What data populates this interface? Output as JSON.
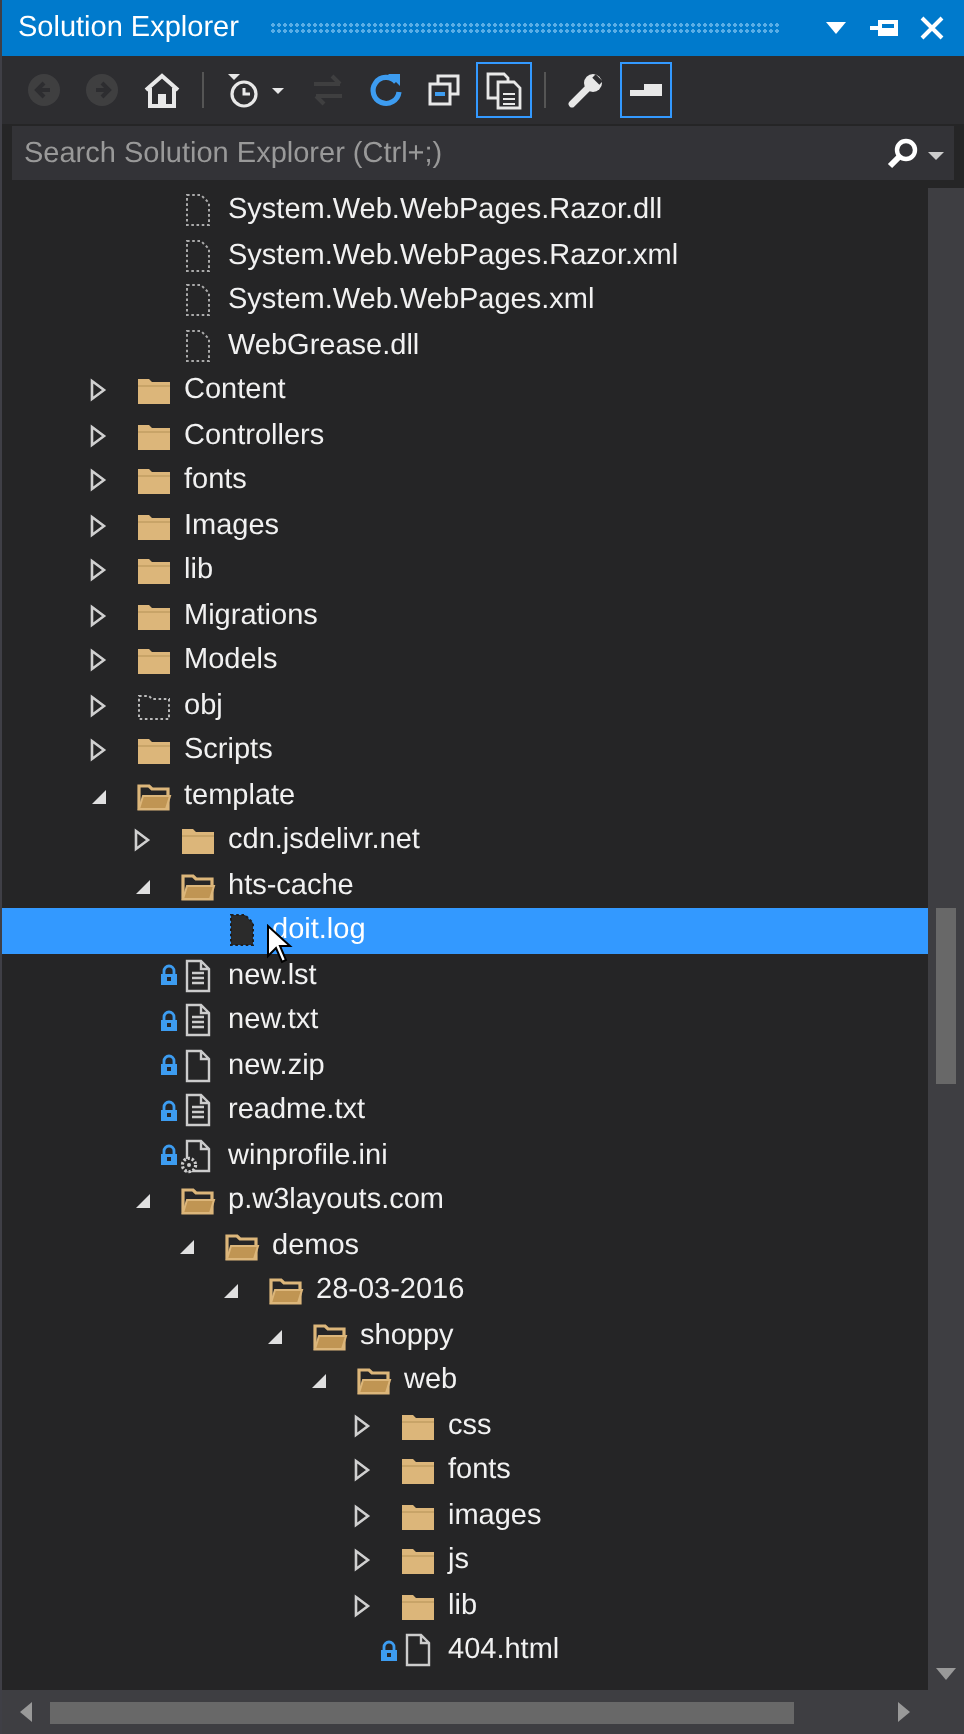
{
  "window": {
    "title": "Solution Explorer"
  },
  "toolbar": [
    {
      "kind": "back",
      "disabled": true,
      "on": false
    },
    {
      "kind": "forward",
      "disabled": true,
      "on": false
    },
    {
      "kind": "home",
      "disabled": false,
      "on": false
    },
    {
      "kind": "separator"
    },
    {
      "kind": "history",
      "disabled": false,
      "on": false
    },
    {
      "kind": "sync",
      "disabled": true,
      "on": false
    },
    {
      "kind": "refresh",
      "disabled": false,
      "on": false
    },
    {
      "kind": "collapse",
      "disabled": false,
      "on": false
    },
    {
      "kind": "show-all",
      "disabled": false,
      "on": true
    },
    {
      "kind": "separator"
    },
    {
      "kind": "properties",
      "disabled": false,
      "on": false
    },
    {
      "kind": "preview",
      "disabled": false,
      "on": true
    }
  ],
  "search": {
    "placeholder": "Search Solution Explorer (Ctrl+;)"
  },
  "tree": {
    "continued_items": [
      {
        "label": "System.Web.WebPages.Razor.dll",
        "kind": "file-excluded",
        "locked": false,
        "selected": false
      },
      {
        "label": "System.Web.WebPages.Razor.xml",
        "kind": "file-excluded",
        "locked": false,
        "selected": false
      },
      {
        "label": "System.Web.WebPages.xml",
        "kind": "file-excluded",
        "locked": false,
        "selected": false
      },
      {
        "label": "WebGrease.dll",
        "kind": "file-excluded",
        "locked": false,
        "selected": false
      }
    ],
    "items": [
      {
        "label": "Content",
        "kind": "folder",
        "expanded": false,
        "selected": false
      },
      {
        "label": "Controllers",
        "kind": "folder",
        "expanded": false,
        "selected": false
      },
      {
        "label": "fonts",
        "kind": "folder",
        "expanded": false,
        "selected": false
      },
      {
        "label": "Images",
        "kind": "folder",
        "expanded": false,
        "selected": false
      },
      {
        "label": "lib",
        "kind": "folder",
        "expanded": false,
        "selected": false
      },
      {
        "label": "Migrations",
        "kind": "folder",
        "expanded": false,
        "selected": false
      },
      {
        "label": "Models",
        "kind": "folder",
        "expanded": false,
        "selected": false
      },
      {
        "label": "obj",
        "kind": "folder-excluded",
        "expanded": false,
        "selected": false
      },
      {
        "label": "Scripts",
        "kind": "folder",
        "expanded": false,
        "selected": false
      },
      {
        "label": "template",
        "kind": "folder",
        "expanded": true,
        "selected": false,
        "children": [
          {
            "label": "cdn.jsdelivr.net",
            "kind": "folder",
            "expanded": false,
            "selected": false
          },
          {
            "label": "hts-cache",
            "kind": "folder",
            "expanded": true,
            "selected": false,
            "children": [
              {
                "label": "doit.log",
                "kind": "file-excluded",
                "locked": false,
                "selected": true
              }
            ]
          },
          {
            "label": "new.lst",
            "kind": "file-text",
            "locked": true,
            "selected": false
          },
          {
            "label": "new.txt",
            "kind": "file-text",
            "locked": true,
            "selected": false
          },
          {
            "label": "new.zip",
            "kind": "file",
            "locked": true,
            "selected": false
          },
          {
            "label": "readme.txt",
            "kind": "file-text",
            "locked": true,
            "selected": false
          },
          {
            "label": "winprofile.ini",
            "kind": "file-config",
            "locked": true,
            "selected": false
          },
          {
            "label": "p.w3layouts.com",
            "kind": "folder",
            "expanded": true,
            "selected": false,
            "children": [
              {
                "label": "demos",
                "kind": "folder",
                "expanded": true,
                "selected": false,
                "children": [
                  {
                    "label": "28-03-2016",
                    "kind": "folder",
                    "expanded": true,
                    "selected": false,
                    "children": [
                      {
                        "label": "shoppy",
                        "kind": "folder",
                        "expanded": true,
                        "selected": false,
                        "children": [
                          {
                            "label": "web",
                            "kind": "folder",
                            "expanded": true,
                            "selected": false,
                            "children": [
                              {
                                "label": "css",
                                "kind": "folder",
                                "expanded": false,
                                "selected": false
                              },
                              {
                                "label": "fonts",
                                "kind": "folder",
                                "expanded": false,
                                "selected": false
                              },
                              {
                                "label": "images",
                                "kind": "folder",
                                "expanded": false,
                                "selected": false
                              },
                              {
                                "label": "js",
                                "kind": "folder",
                                "expanded": false,
                                "selected": false
                              },
                              {
                                "label": "lib",
                                "kind": "folder",
                                "expanded": false,
                                "selected": false
                              },
                              {
                                "label": "404.html",
                                "kind": "file",
                                "locked": true,
                                "selected": false
                              }
                            ]
                          }
                        ]
                      }
                    ]
                  }
                ]
              }
            ]
          }
        ]
      }
    ]
  }
}
